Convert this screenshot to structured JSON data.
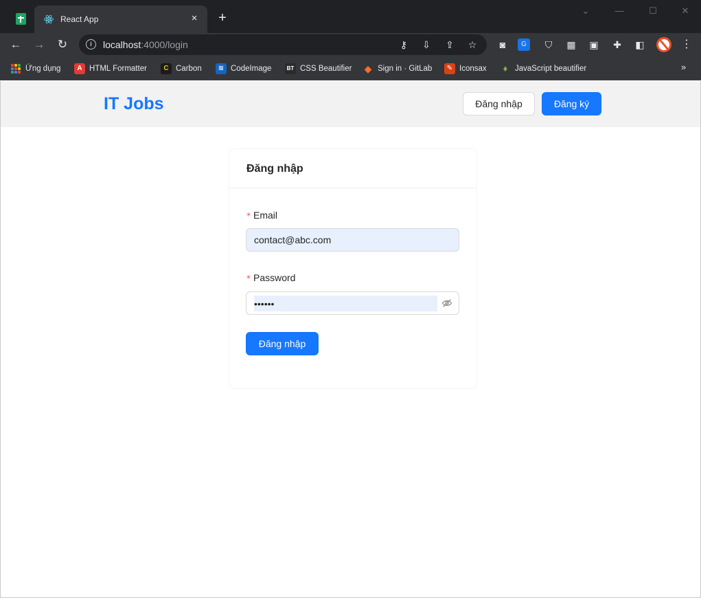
{
  "browser": {
    "tab_title": "React App",
    "tab_close": "×",
    "new_tab": "+",
    "url_host": "localhost",
    "url_path": ":4000/login",
    "window_controls": [
      "⌄",
      "—",
      "☐",
      "✕"
    ],
    "bookmarks": [
      {
        "label": "Ứng dụng",
        "icon": "apps-grid-icon"
      },
      {
        "label": "HTML Formatter",
        "icon": "html-formatter-icon",
        "color": "#e53935",
        "glyph": "A"
      },
      {
        "label": "Carbon",
        "icon": "carbon-icon",
        "color": "#1b1b1b",
        "glyph": "C"
      },
      {
        "label": "CodeImage",
        "icon": "codeimage-icon",
        "color": "#1565c0",
        "glyph": "≋"
      },
      {
        "label": "CSS Beautifier",
        "icon": "css-beautifier-icon",
        "color": "#2b2b2b",
        "glyph": "BT"
      },
      {
        "label": "Sign in · GitLab",
        "icon": "gitlab-icon",
        "color": "#fc6d26",
        "glyph": "◆"
      },
      {
        "label": "Iconsax",
        "icon": "iconsax-icon",
        "color": "#d84315",
        "glyph": "✎"
      },
      {
        "label": "JavaScript beautifier",
        "icon": "js-beautifier-icon",
        "color": "#7cb342",
        "glyph": "♦"
      }
    ],
    "bookmarks_more": "»"
  },
  "header": {
    "logo": "IT Jobs",
    "login_label": "Đăng nhập",
    "register_label": "Đăng ký"
  },
  "login_form": {
    "title": "Đăng nhập",
    "email_label": "Email",
    "email_value": "contact@abc.com",
    "password_label": "Password",
    "password_value": "123456",
    "submit_label": "Đăng nhập",
    "required_mark": "*"
  },
  "colors": {
    "primary": "#1677ff",
    "autofill": "#e8f0fe",
    "required": "#ff4d4f",
    "header_bg": "#f2f2f3"
  }
}
